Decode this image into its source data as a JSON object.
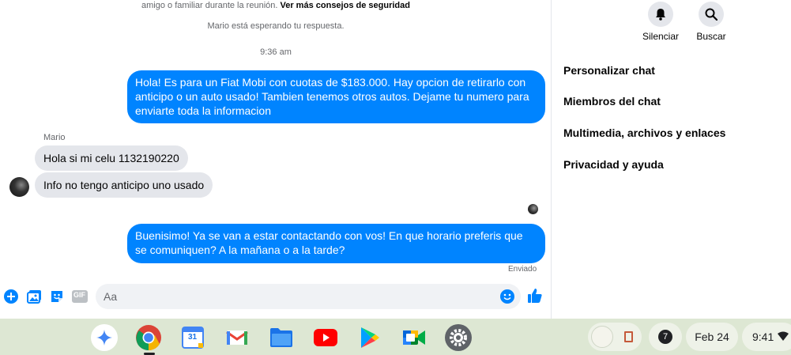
{
  "chat": {
    "safety_text": "amigo o familiar durante la reunión.",
    "safety_link": "Ver más consejos de seguridad",
    "waiting": "Mario está esperando tu respuesta.",
    "timestamp": "9:36 am",
    "sender_name": "Mario",
    "status": "Enviado",
    "messages": [
      {
        "direction": "out",
        "text": "Hola! Es para un Fiat Mobi con cuotas de $183.000. Hay opcion de retirarlo con anticipo o un auto usado! Tambien tenemos otros autos. Dejame tu numero para enviarte toda la informacion"
      },
      {
        "direction": "in",
        "text": "Hola si mi celu 1132190220"
      },
      {
        "direction": "in",
        "text": "Info no tengo anticipo uno usado"
      },
      {
        "direction": "out",
        "text": "Buenisimo! Ya se van a estar contactando con vos! En que horario preferis que se comuniquen? A la mañana o a la tarde?"
      }
    ]
  },
  "composer": {
    "placeholder": "Aa",
    "icons": [
      "plus-icon",
      "photo-icon",
      "sticker-icon",
      "gif-icon",
      "emoji-icon",
      "thumbs-up-icon"
    ],
    "gif_label": "GIF"
  },
  "side": {
    "mute_label": "Silenciar",
    "search_label": "Buscar",
    "items": [
      "Personalizar chat",
      "Miembros del chat",
      "Multimedia, archivos y enlaces",
      "Privacidad y ayuda"
    ]
  },
  "shelf": {
    "apps": [
      "gemini",
      "chrome",
      "calendar",
      "gmail",
      "files",
      "youtube",
      "play-store",
      "meet",
      "settings"
    ],
    "calendar_day": "31",
    "notification_count": "7",
    "date": "Feb 24",
    "time": "9:41"
  },
  "colors": {
    "outgoing_bubble": "#0084ff",
    "incoming_bubble": "#e4e6eb",
    "shelf": "#dde7d3"
  }
}
